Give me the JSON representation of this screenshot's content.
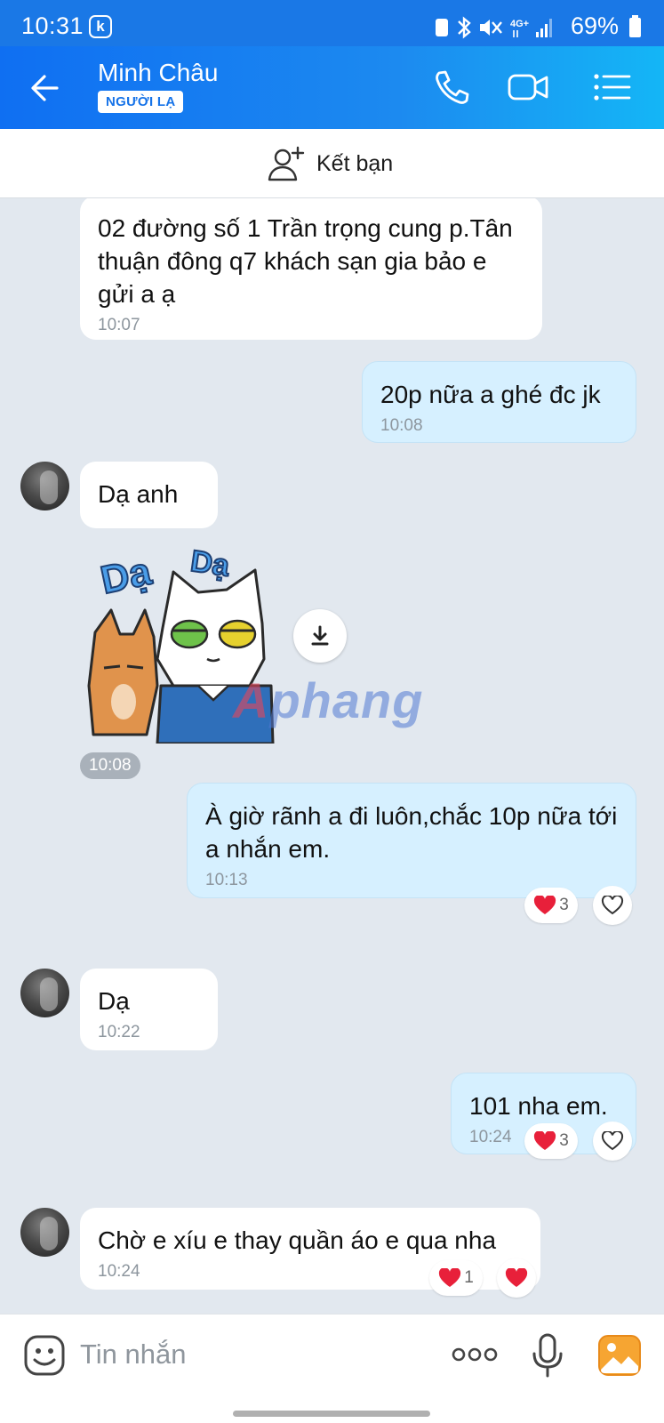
{
  "status_bar": {
    "time": "10:31",
    "app_badge": "k",
    "network": "4G+",
    "battery": "69%"
  },
  "header": {
    "contact_name": "Minh Châu",
    "badge": "NGƯỜI LẠ",
    "icons": [
      "back-arrow-icon",
      "phone-icon",
      "video-call-icon",
      "menu-icon"
    ]
  },
  "friend_bar": {
    "label": "Kết bạn",
    "icon": "add-friend-icon"
  },
  "messages": [
    {
      "direction": "in",
      "text": "02 đường số 1 Trần trọng cung p.Tân thuận đông q7 khách sạn gia bảo e gửi a ạ",
      "time": "10:07"
    },
    {
      "direction": "out",
      "text": "20p nữa a ghé đc jk",
      "time": "10:08"
    },
    {
      "direction": "in",
      "text": "Dạ anh"
    },
    {
      "direction": "in",
      "type": "sticker",
      "sticker_text": "Dạ Dạ",
      "time": "10:08"
    },
    {
      "direction": "out",
      "text": "À giờ rãnh a đi luôn,chắc 10p nữa tới a nhắn em.",
      "time": "10:13",
      "reaction_count": "3"
    },
    {
      "direction": "in",
      "text": "Dạ",
      "time": "10:22"
    },
    {
      "direction": "out",
      "text": "101 nha em.",
      "time": "10:24",
      "reaction_count": "3"
    },
    {
      "direction": "in",
      "text": "Chờ e xíu e thay quần áo e qua nha",
      "time": "10:24",
      "reaction_count": "1"
    }
  ],
  "watermark": {
    "first": "A",
    "rest": "phang"
  },
  "input_bar": {
    "placeholder": "Tin nhắn",
    "icons": [
      "emoji-icon",
      "more-icon",
      "microphone-icon",
      "image-icon"
    ]
  },
  "colors": {
    "header": "#1a78e6",
    "outgoing_bubble": "#d6f0ff",
    "incoming_bubble": "#ffffff",
    "chat_bg": "#e2e8ef",
    "heart": "#e8203a"
  }
}
